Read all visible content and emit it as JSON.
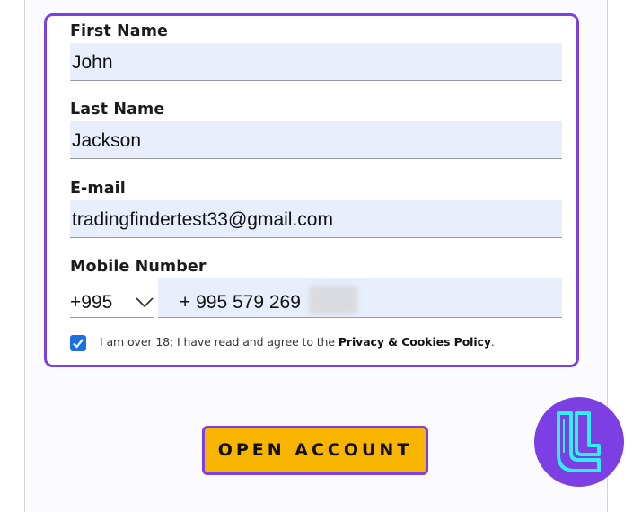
{
  "form": {
    "first_name": {
      "label": "First Name",
      "value": "John"
    },
    "last_name": {
      "label": "Last Name",
      "value": "Jackson"
    },
    "email": {
      "label": "E-mail",
      "value": "tradingfindertest33@gmail.com"
    },
    "mobile": {
      "label": "Mobile Number",
      "country_code": "+995",
      "number": "+ 995 579 269"
    },
    "consent": {
      "checked": true,
      "text": "I am over 18; I have read and agree to the ",
      "link_text": "Privacy & Cookies Policy",
      "suffix": "."
    },
    "submit_label": "OPEN ACCOUNT"
  },
  "colors": {
    "accent": "#7b3fe4",
    "button": "#f7b500",
    "input_bg": "#e8eefb",
    "checkbox": "#1b6fe0",
    "logo_bg": "#7b3fe4",
    "logo_mark": "#2ff0f0"
  },
  "icons": {
    "dropdown": "chevron-down-icon",
    "checkbox": "checkmark-icon",
    "watermark": "tradingfinder-logo"
  }
}
